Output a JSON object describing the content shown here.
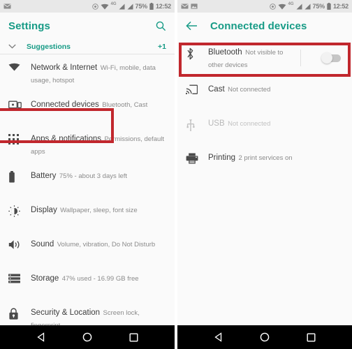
{
  "accent_color": "#179b86",
  "highlight_color": "#c1272d",
  "background_color": "#fafafa",
  "statusbar": {
    "time": "12:52",
    "battery_percent": "75%",
    "network_type": "4G",
    "left_icons_screen1": [
      "envelope-icon"
    ],
    "left_icons_screen2": [
      "envelope-icon",
      "photo-icon"
    ],
    "right_icons": [
      "location-icon",
      "wifi-icon",
      "signal-icon",
      "signal-icon",
      "battery-icon"
    ]
  },
  "screen1": {
    "appbar": {
      "title": "Settings",
      "search_icon": "search-icon"
    },
    "suggestions": {
      "chevron_icon": "chevron-down-icon",
      "label": "Suggestions",
      "count": "+1"
    },
    "items": [
      {
        "icon": "wifi-icon",
        "title": "Network & Internet",
        "subtitle": "Wi-Fi, mobile, data usage, hotspot",
        "highlighted": false,
        "disabled": false
      },
      {
        "icon": "connected-devices-icon",
        "title": "Connected devices",
        "subtitle": "Bluetooth, Cast",
        "highlighted": true,
        "disabled": false
      },
      {
        "icon": "apps-grid-icon",
        "title": "Apps & notifications",
        "subtitle": "Permissions, default apps",
        "highlighted": false,
        "disabled": false
      },
      {
        "icon": "battery-icon",
        "title": "Battery",
        "subtitle": "75% - about 3 days left",
        "highlighted": false,
        "disabled": false
      },
      {
        "icon": "brightness-icon",
        "title": "Display",
        "subtitle": "Wallpaper, sleep, font size",
        "highlighted": false,
        "disabled": false
      },
      {
        "icon": "volume-icon",
        "title": "Sound",
        "subtitle": "Volume, vibration, Do Not Disturb",
        "highlighted": false,
        "disabled": false
      },
      {
        "icon": "storage-icon",
        "title": "Storage",
        "subtitle": "47% used - 16.99 GB free",
        "highlighted": false,
        "disabled": false
      },
      {
        "icon": "lock-icon",
        "title": "Security & Location",
        "subtitle": "Screen lock, fingerprint",
        "highlighted": false,
        "disabled": false
      }
    ]
  },
  "screen2": {
    "appbar": {
      "back_icon": "arrow-back-icon",
      "title": "Connected devices"
    },
    "items": [
      {
        "icon": "bluetooth-icon",
        "title": "Bluetooth",
        "subtitle": "Not visible to other devices",
        "toggle": "off",
        "highlighted": true,
        "disabled": false
      },
      {
        "icon": "cast-icon",
        "title": "Cast",
        "subtitle": "Not connected",
        "highlighted": false,
        "disabled": false
      },
      {
        "icon": "usb-icon",
        "title": "USB",
        "subtitle": "Not connected",
        "highlighted": false,
        "disabled": true
      },
      {
        "icon": "printer-icon",
        "title": "Printing",
        "subtitle": "2 print services on",
        "highlighted": false,
        "disabled": false
      }
    ]
  },
  "navbar": {
    "back_label": "back-triangle-icon",
    "home_label": "home-circle-icon",
    "recents_label": "recents-square-icon"
  }
}
